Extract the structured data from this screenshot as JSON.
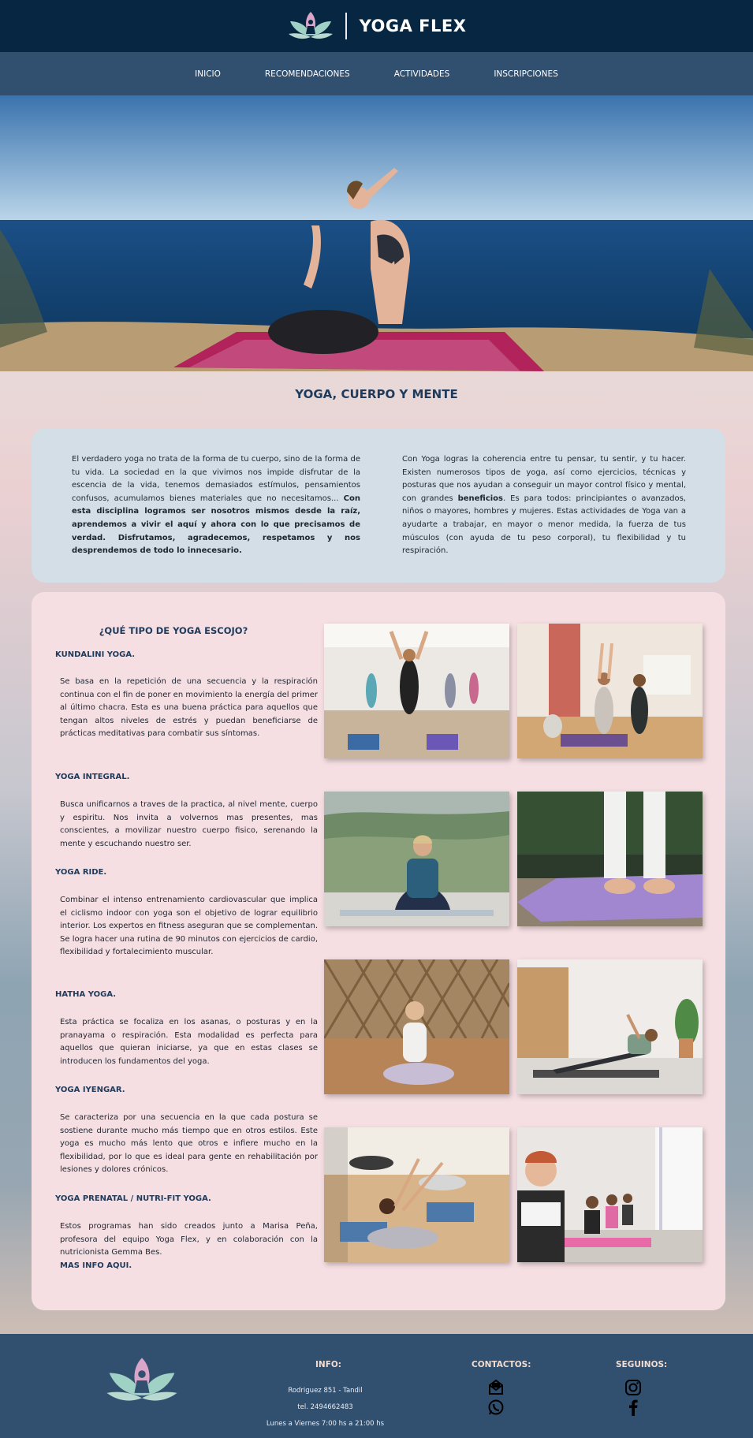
{
  "header": {
    "brand": "YOGA FLEX"
  },
  "nav": {
    "items": [
      {
        "label": "INICIO"
      },
      {
        "label": "RECOMENDACIONES"
      },
      {
        "label": "ACTIVIDADES"
      },
      {
        "label": "INSCRIPCIONES"
      }
    ]
  },
  "hero": {
    "title": "YOGA, CUERPO Y MENTE"
  },
  "intro": {
    "left_text": "El verdadero yoga no trata de la forma de tu cuerpo, sino de la forma de tu vida. La sociedad en la que vivimos nos impide disfrutar de la escencia de la vida, tenemos demasiados estímulos, pensamientos confusos, acumulamos bienes materiales que no necesitamos...",
    "left_bold": "Con esta disciplina logramos ser nosotros mismos desde la raíz, aprendemos a vivir el aquí y ahora con lo que precisamos de verdad. Disfrutamos, agradecemos, respetamos y nos desprendemos de todo lo innecesario.",
    "right_text_1": "Con Yoga logras la coherencia entre tu pensar, tu sentir, y tu hacer. Existen numerosos tipos de yoga, así como ejercicios, técnicas y posturas que nos ayudan a conseguir un mayor control físico y mental, con grandes",
    "right_bold": "beneficios",
    "right_text_2": ". Es para todos: principiantes o avanzados, niños o mayores, hombres y mujeres. Estas actividades de Yoga van a ayudarte a trabajar, en mayor o menor medida, la fuerza de tus músculos (con ayuda de tu peso corporal), tu flexibilidad y tu respiración."
  },
  "types": {
    "title": "¿QUÉ TIPO DE YOGA ESCOJO?",
    "items": [
      {
        "name": "KUNDALINI YOGA.",
        "description": "Se basa en la repetición de una secuencia y la respiración continua con el fin de poner en movimiento la energía del primer al último chacra. Esta es una buena práctica para aquellos que tengan altos niveles de estrés y puedan beneficiarse de prácticas meditativas para combatir sus síntomas."
      },
      {
        "name": "YOGA INTEGRAL.",
        "description": "Busca unificarnos a traves de la practica, al nivel mente, cuerpo y espiritu. Nos invita a volvernos mas presentes, mas conscientes, a movilizar nuestro cuerpo fisico, serenando la mente y escuchando nuestro ser."
      },
      {
        "name": "YOGA RIDE.",
        "description": "Combinar el intenso entrenamiento cardiovascular que implica el ciclismo indoor con yoga son el objetivo de lograr equilibrio interior. Los expertos en fitness aseguran que se complementan. Se logra hacer una rutina de 90 minutos con ejercicios de cardio, flexibilidad y fortalecimiento muscular."
      },
      {
        "name": "HATHA YOGA.",
        "description": "Esta práctica se focaliza en los asanas, o posturas y en la pranayama o respiración. Esta modalidad es perfecta para aquellos que quieran iniciarse, ya que en estas clases se introducen los fundamentos del yoga."
      },
      {
        "name": "YOGA IYENGAR.",
        "description": "Se caracteriza por una secuencia en la que cada postura se sostiene durante mucho más tiempo que en otros estilos. Este yoga es mucho más lento que otros e infiere mucho en la flexibilidad, por lo que es ideal para gente en rehabilitación por lesiones y dolores crónicos."
      },
      {
        "name": "YOGA PRENATAL / NUTRI-FIT YOGA.",
        "description": "Estos programas han sido creados junto a Marisa Peña, profesora del equipo Yoga Flex, y en colaboración con la nutricionista Gemma Bes."
      }
    ],
    "more_link": "MAS INFO AQUI."
  },
  "footer": {
    "info_title": "INFO:",
    "address": "Rodriguez 851 - Tandil",
    "phone": "tel. 2494662483",
    "hours": "Lunes a Viernes 7:00 hs a 21:00 hs",
    "contacts_title": "CONTACTOS:",
    "follow_title": "SEGUINOS:",
    "icons": [
      "mail-icon",
      "whatsapp-icon",
      "instagram-icon",
      "facebook-icon"
    ]
  },
  "colors": {
    "header_bg": "#062641",
    "nav_bg": "#314f6f",
    "title_color": "#1f3a5b",
    "intro_box": "#d4dee6",
    "types_box": "#f5dfe2",
    "footer_heading": "#f2dcd0"
  }
}
